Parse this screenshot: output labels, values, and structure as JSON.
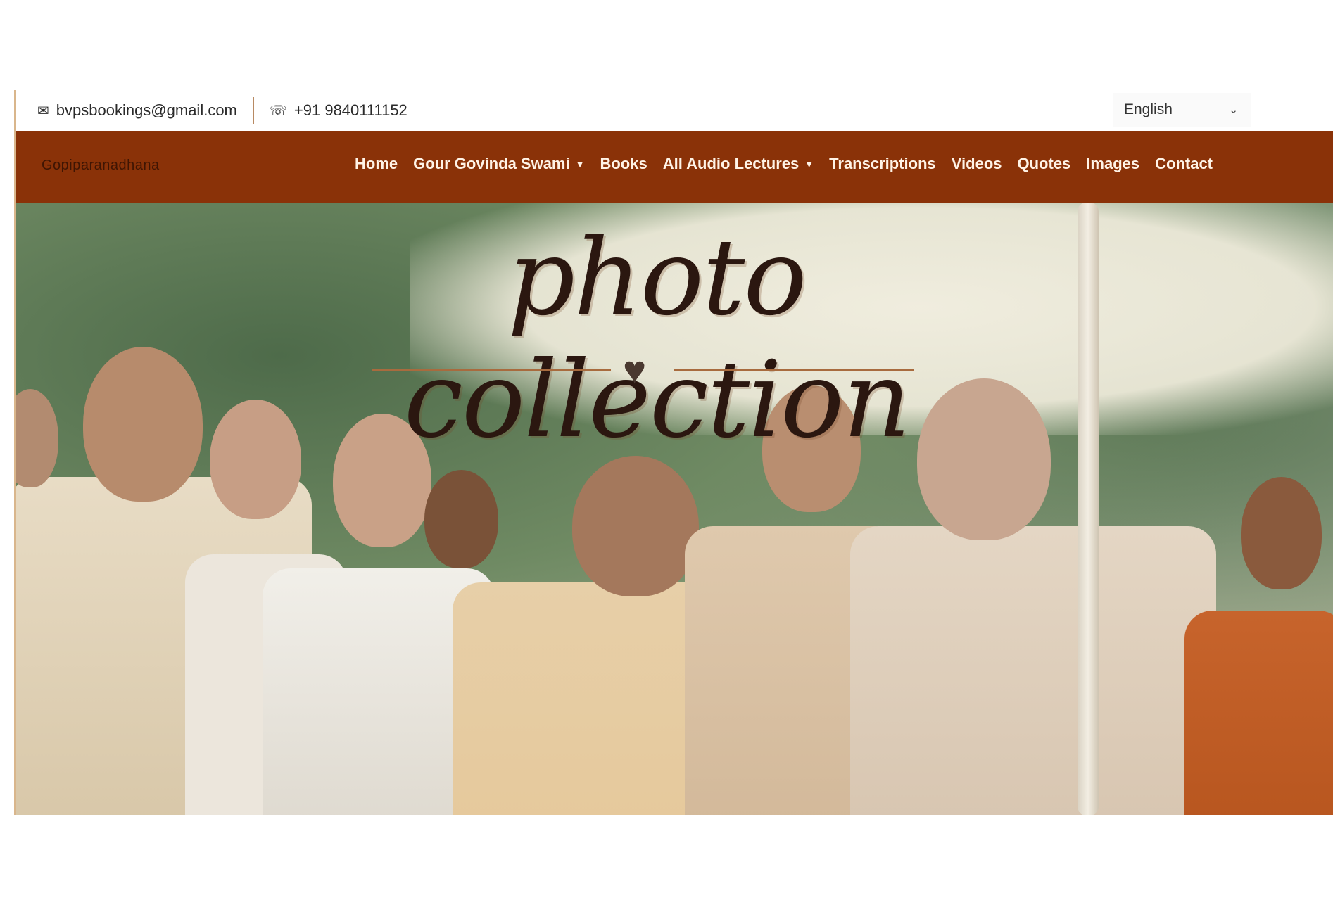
{
  "topbar": {
    "email_icon": "envelope-icon",
    "email": "bvpsbookings@gmail.com",
    "phone_icon": "phone-icon",
    "phone": "+91 9840111152",
    "language": {
      "selected": "English",
      "icon": "chevron-down-icon"
    }
  },
  "nav": {
    "brand": "Gopiparanadhana",
    "items": [
      {
        "label": "Home",
        "has_dropdown": false
      },
      {
        "label": "Gour Govinda Swami",
        "has_dropdown": true
      },
      {
        "label": "Books",
        "has_dropdown": false
      },
      {
        "label": "All Audio Lectures",
        "has_dropdown": true
      },
      {
        "label": "Transcriptions",
        "has_dropdown": false
      },
      {
        "label": "Videos",
        "has_dropdown": false
      },
      {
        "label": "Quotes",
        "has_dropdown": false
      },
      {
        "label": "Images",
        "has_dropdown": false
      },
      {
        "label": "Contact",
        "has_dropdown": false
      }
    ],
    "caret_icon": "caret-down-icon"
  },
  "hero": {
    "title": "photo collection",
    "ornament_icon": "heart-icon"
  },
  "colors": {
    "nav_bg": "#8a3208",
    "nav_text": "#fff3e6",
    "accent_line": "#a86b3e",
    "frame_border": "#d9b68c"
  }
}
